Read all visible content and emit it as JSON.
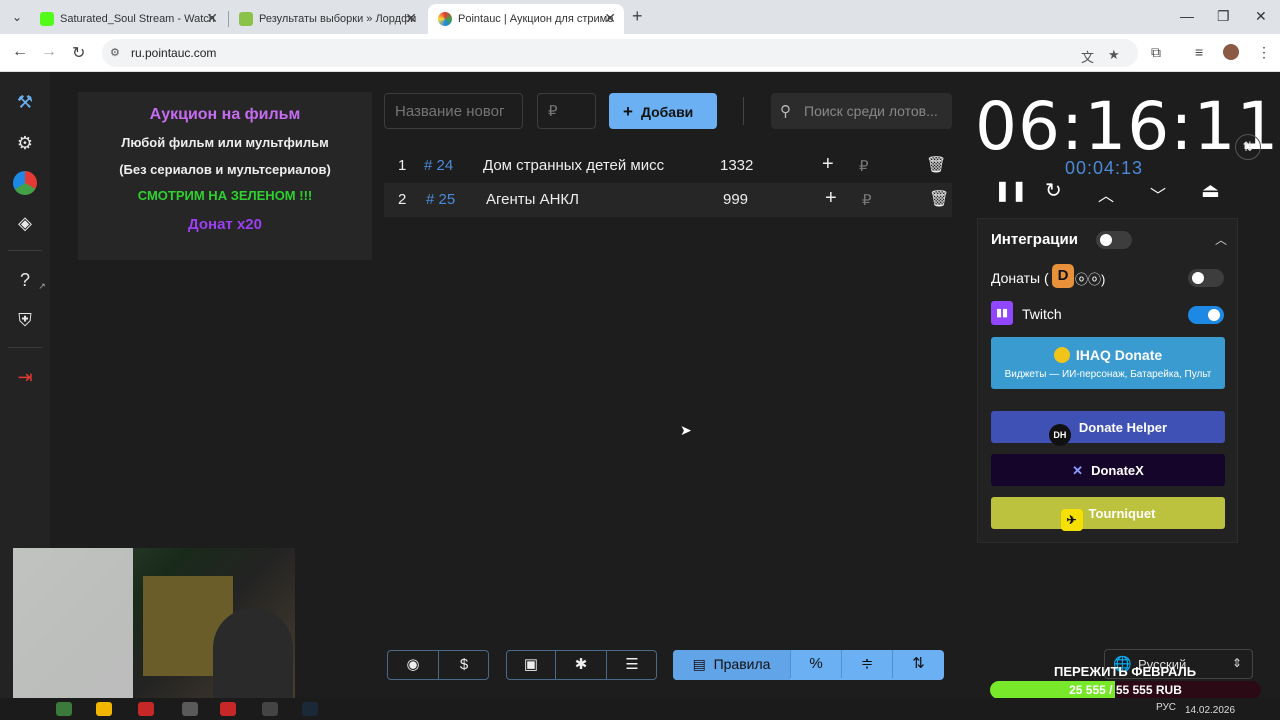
{
  "browser": {
    "tabs": [
      {
        "label": "Saturated_Soul Stream - Watch"
      },
      {
        "label": "Результаты выборки » Лордфи"
      },
      {
        "label": "Pointauc | Аукцион для стриме"
      }
    ],
    "url": "ru.pointauc.com"
  },
  "description": {
    "line1": "Аукцион на фильм",
    "line2": "Любой фильм или мультфильм",
    "line3": "(Без сериалов и мультсериалов)",
    "line4": "СМОТРИМ НА ЗЕЛЕНОМ !!!",
    "line5": "Донат x20"
  },
  "toolbar": {
    "name_placeholder": "Название новог",
    "amount_placeholder": "₽",
    "add_label": "Добави",
    "search_placeholder": "Поиск среди лотов..."
  },
  "lots": [
    {
      "index": "1",
      "tag": "# 24",
      "name": "Дом странных детей мисс",
      "amount": "1332",
      "currency": "₽"
    },
    {
      "index": "2",
      "tag": "# 25",
      "name": "Агенты АНКЛ",
      "amount": "999",
      "currency": "₽"
    }
  ],
  "timer": {
    "main": "06:16:11",
    "secondary": "00:04:13"
  },
  "integrations": {
    "title": "Интеграции",
    "enabled": false,
    "donations_label_prefix": "Донаты (",
    "donations_label_suffix": "ⓞⓞ)",
    "donations_logo": "D",
    "donations_enabled": false,
    "twitch_label": "Twitch",
    "twitch_enabled": true,
    "ihaq_title": "IHAQ Donate",
    "ihaq_subtitle": "Виджеты — ИИ-персонаж, Батарейка, Пульт",
    "donate_helper_badge": "DH",
    "donate_helper_label": "Donate Helper",
    "donatex_label": "DonateX",
    "tourniquet_label": "Tourniquet"
  },
  "bottom_bar": {
    "rules_label": "Правила",
    "percent_label": "%"
  },
  "language": {
    "selected": "Русский"
  },
  "goal": {
    "title": "ПЕРЕЖИТЬ ФЕВРАЛЬ",
    "text": "25 555 / 55 555 RUB",
    "progress": 0.46
  },
  "taskbar": {
    "lang": "РУС",
    "date": "14.02.2026"
  },
  "colors": {
    "accent": "#6ab0f3",
    "purple_text": "#c56cf0",
    "green_text": "#2fd12f",
    "tag_blue": "#4b8ad8"
  }
}
